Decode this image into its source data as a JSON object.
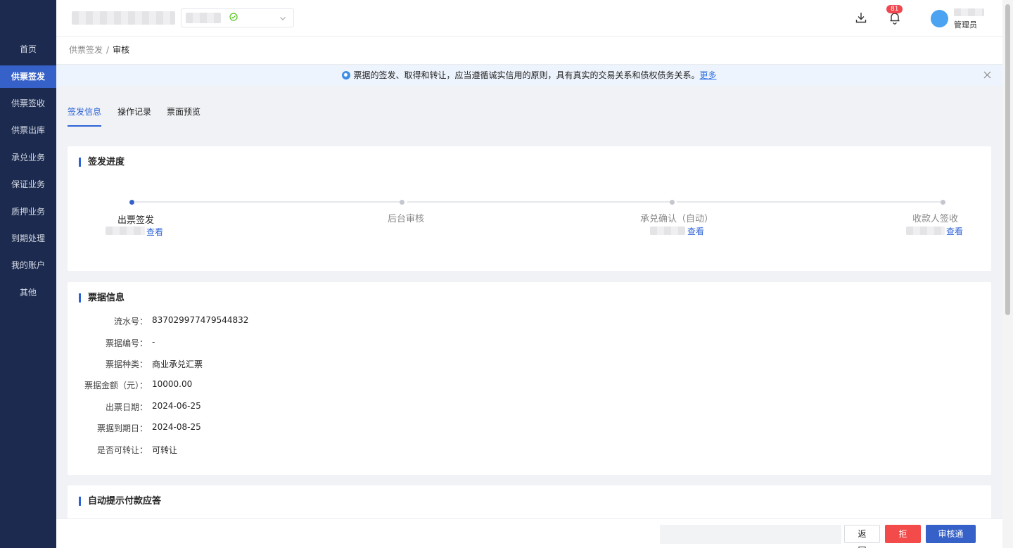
{
  "sidebar": {
    "items": [
      {
        "label": "首页"
      },
      {
        "label": "供票签发",
        "active": true
      },
      {
        "label": "供票签收"
      },
      {
        "label": "供票出库"
      },
      {
        "label": "承兑业务"
      },
      {
        "label": "保证业务"
      },
      {
        "label": "质押业务"
      },
      {
        "label": "到期处理"
      },
      {
        "label": "我的账户"
      },
      {
        "label": "其他"
      }
    ]
  },
  "header": {
    "notification_count": "81",
    "user_role": "管理员",
    "icons": [
      "download-icon",
      "bell-icon",
      "check-circle-icon",
      "chevron-down-icon"
    ]
  },
  "breadcrumb": {
    "parent": "供票签发",
    "separator": "/",
    "current": "审核"
  },
  "notice": {
    "text": "票据的签发、取得和转让，应当遵循诚实信用的原则，具有真实的交易关系和债权债务关系。",
    "link": "更多"
  },
  "tabs": [
    {
      "label": "签发信息",
      "active": true
    },
    {
      "label": "操作记录"
    },
    {
      "label": "票面预览"
    }
  ],
  "progress": {
    "title": "签发进度",
    "steps": [
      {
        "label": "出票签发",
        "link": "查看",
        "active": true
      },
      {
        "label": "后台审核"
      },
      {
        "label": "承兑确认（自动）",
        "link": "查看"
      },
      {
        "label": "收款人签收",
        "link": "查看"
      }
    ]
  },
  "bill_info": {
    "title": "票据信息",
    "rows": [
      {
        "label": "流水号：",
        "value": "837029977479544832"
      },
      {
        "label": "票据编号：",
        "value": "-"
      },
      {
        "label": "票据种类：",
        "value": "商业承兑汇票"
      },
      {
        "label": "票据金额（元）：",
        "value": "10000.00"
      },
      {
        "label": "出票日期：",
        "value": "2024-06-25"
      },
      {
        "label": "票据到期日：",
        "value": "2024-08-25"
      },
      {
        "label": "是否可转让：",
        "value": "可转让"
      }
    ]
  },
  "auto_reply": {
    "title": "自动提示付款应答"
  },
  "footer": {
    "back_label": "返 回",
    "reject_label": "拒 绝",
    "approve_label": "审核通过"
  },
  "colors": {
    "sidebar_bg": "#1b2a4e",
    "accent": "#3561c9",
    "danger": "#f34a4a",
    "badge": "#f0474f"
  }
}
